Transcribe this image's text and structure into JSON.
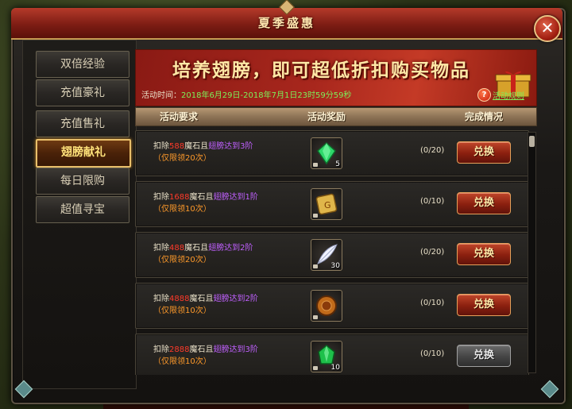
{
  "window": {
    "title": "夏季盛惠",
    "close_label": "✕"
  },
  "sidebar": {
    "items": [
      {
        "label": "双倍经验",
        "active": false
      },
      {
        "label": "充值豪礼",
        "active": false
      },
      {
        "label": "充值售礼",
        "active": false
      },
      {
        "label": "翅膀献礼",
        "active": true
      },
      {
        "label": "每日限购",
        "active": false
      },
      {
        "label": "超值寻宝",
        "active": false
      }
    ]
  },
  "banner": {
    "headline": "培养翅膀，即可超低折扣购买物品",
    "time_label": "活动时间：",
    "time_value": "2018年6月29日-2018年7月1日23时59分59秒",
    "rules_label": "活动规则",
    "help_icon": "?"
  },
  "table": {
    "headers": {
      "requirement": "活动要求",
      "reward": "活动奖励",
      "status": "完成情况"
    },
    "rows": [
      {
        "req_prefix": "扣除",
        "cost": "588",
        "currency": "魔石且",
        "wing": "翅膀达到3阶",
        "limit": "（仅限领20次）",
        "item_icon": "green-gem-icon",
        "item_count": "5",
        "progress": "(0/20)",
        "button_label": "兑换",
        "button_enabled": true
      },
      {
        "req_prefix": "扣除",
        "cost": "1688",
        "currency": "魔石且",
        "wing": "翅膀达到1阶",
        "limit": "（仅限领10次）",
        "item_icon": "golden-scroll-icon",
        "item_count": "",
        "progress": "(0/10)",
        "button_label": "兑换",
        "button_enabled": true
      },
      {
        "req_prefix": "扣除",
        "cost": "488",
        "currency": "魔石且",
        "wing": "翅膀达到2阶",
        "limit": "（仅限领20次）",
        "item_icon": "white-feather-icon",
        "item_count": "30",
        "progress": "(0/20)",
        "button_label": "兑换",
        "button_enabled": true
      },
      {
        "req_prefix": "扣除",
        "cost": "4888",
        "currency": "魔石且",
        "wing": "翅膀达到2阶",
        "limit": "（仅限领10次）",
        "item_icon": "bronze-coin-icon",
        "item_count": "",
        "progress": "(0/10)",
        "button_label": "兑换",
        "button_enabled": true
      },
      {
        "req_prefix": "扣除",
        "cost": "2888",
        "currency": "魔石且",
        "wing": "翅膀达到3阶",
        "limit": "（仅限领10次）",
        "item_icon": "green-crystal-icon",
        "item_count": "10",
        "progress": "(0/10)",
        "button_label": "兑换",
        "button_enabled": false
      }
    ]
  },
  "colors": {
    "accent_red": "#a8271d",
    "gold": "#e9bf6a",
    "cost_red": "#ff3a2a",
    "wing_purple": "#c060ff",
    "limit_orange": "#ff9a2a",
    "time_green": "#7cf05a"
  }
}
